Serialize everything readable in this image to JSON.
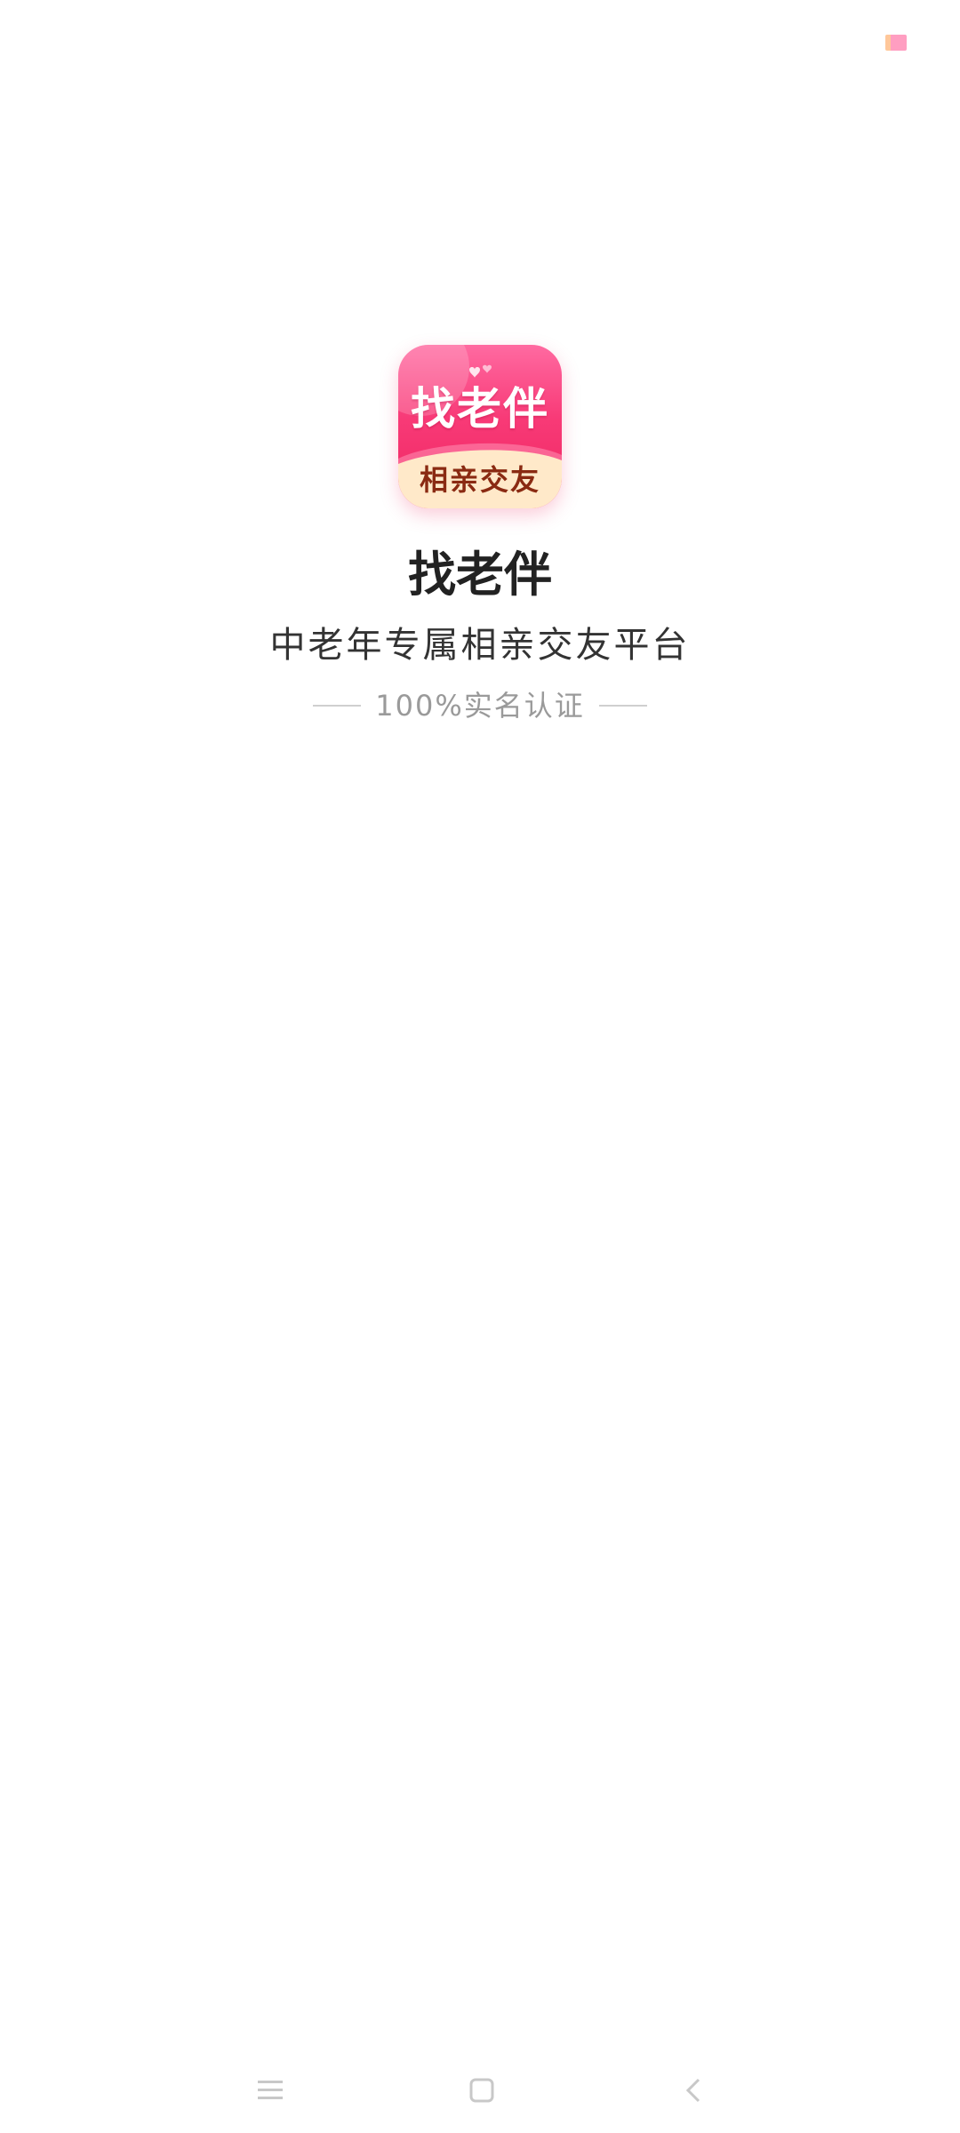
{
  "app_icon": {
    "main_text": "找老伴",
    "sub_text": "相亲交友",
    "colors": {
      "gradient_top": "#ff6aa1",
      "gradient_bottom": "#ef2560",
      "band": "#ffe9c9",
      "sub_text": "#8a2a12"
    },
    "decor_icon": "hearts-icon"
  },
  "splash": {
    "app_name": "找老伴",
    "tagline": "中老年专属相亲交友平台",
    "certification": "100%实名认证"
  },
  "status_bar": {
    "indicator_icon": "notification-indicator-icon"
  },
  "nav_bar": {
    "menu_icon": "menu-icon",
    "home_icon": "home-icon",
    "back_icon": "back-icon"
  }
}
